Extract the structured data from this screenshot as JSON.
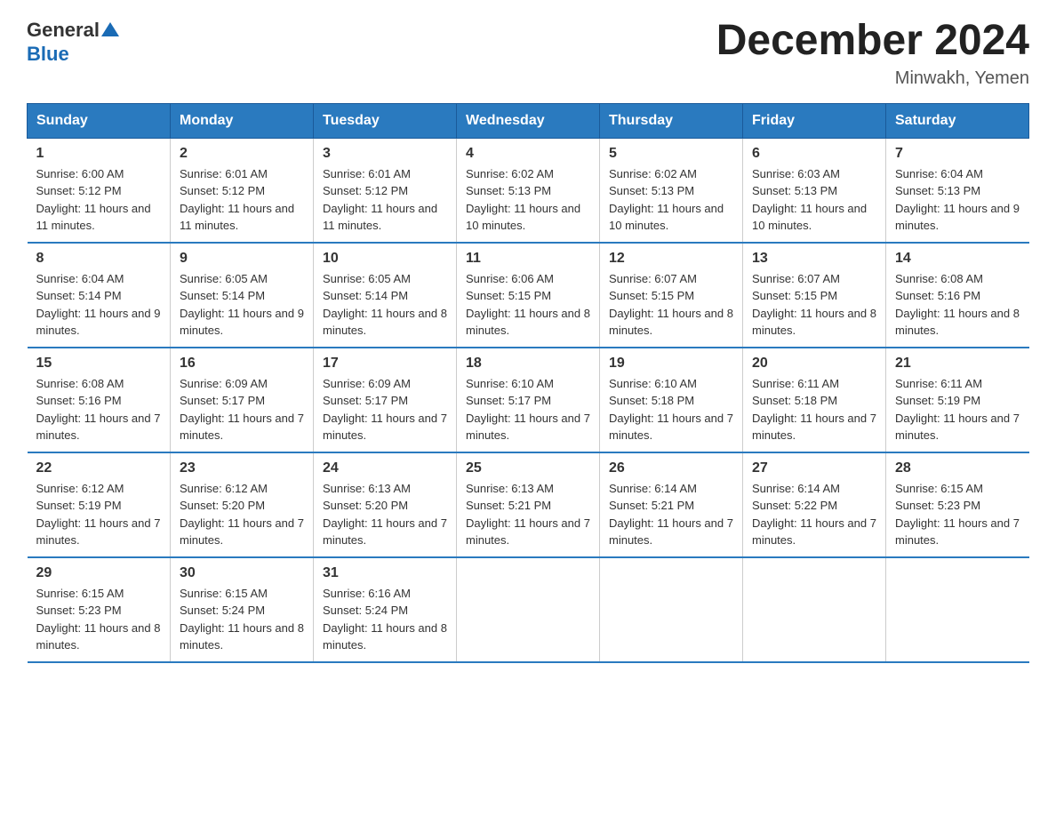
{
  "header": {
    "logo_general": "General",
    "logo_blue": "Blue",
    "month_title": "December 2024",
    "location": "Minwakh, Yemen"
  },
  "weekdays": [
    "Sunday",
    "Monday",
    "Tuesday",
    "Wednesday",
    "Thursday",
    "Friday",
    "Saturday"
  ],
  "weeks": [
    [
      {
        "day": "1",
        "sunrise": "6:00 AM",
        "sunset": "5:12 PM",
        "daylight": "11 hours and 11 minutes."
      },
      {
        "day": "2",
        "sunrise": "6:01 AM",
        "sunset": "5:12 PM",
        "daylight": "11 hours and 11 minutes."
      },
      {
        "day": "3",
        "sunrise": "6:01 AM",
        "sunset": "5:12 PM",
        "daylight": "11 hours and 11 minutes."
      },
      {
        "day": "4",
        "sunrise": "6:02 AM",
        "sunset": "5:13 PM",
        "daylight": "11 hours and 10 minutes."
      },
      {
        "day": "5",
        "sunrise": "6:02 AM",
        "sunset": "5:13 PM",
        "daylight": "11 hours and 10 minutes."
      },
      {
        "day": "6",
        "sunrise": "6:03 AM",
        "sunset": "5:13 PM",
        "daylight": "11 hours and 10 minutes."
      },
      {
        "day": "7",
        "sunrise": "6:04 AM",
        "sunset": "5:13 PM",
        "daylight": "11 hours and 9 minutes."
      }
    ],
    [
      {
        "day": "8",
        "sunrise": "6:04 AM",
        "sunset": "5:14 PM",
        "daylight": "11 hours and 9 minutes."
      },
      {
        "day": "9",
        "sunrise": "6:05 AM",
        "sunset": "5:14 PM",
        "daylight": "11 hours and 9 minutes."
      },
      {
        "day": "10",
        "sunrise": "6:05 AM",
        "sunset": "5:14 PM",
        "daylight": "11 hours and 8 minutes."
      },
      {
        "day": "11",
        "sunrise": "6:06 AM",
        "sunset": "5:15 PM",
        "daylight": "11 hours and 8 minutes."
      },
      {
        "day": "12",
        "sunrise": "6:07 AM",
        "sunset": "5:15 PM",
        "daylight": "11 hours and 8 minutes."
      },
      {
        "day": "13",
        "sunrise": "6:07 AM",
        "sunset": "5:15 PM",
        "daylight": "11 hours and 8 minutes."
      },
      {
        "day": "14",
        "sunrise": "6:08 AM",
        "sunset": "5:16 PM",
        "daylight": "11 hours and 8 minutes."
      }
    ],
    [
      {
        "day": "15",
        "sunrise": "6:08 AM",
        "sunset": "5:16 PM",
        "daylight": "11 hours and 7 minutes."
      },
      {
        "day": "16",
        "sunrise": "6:09 AM",
        "sunset": "5:17 PM",
        "daylight": "11 hours and 7 minutes."
      },
      {
        "day": "17",
        "sunrise": "6:09 AM",
        "sunset": "5:17 PM",
        "daylight": "11 hours and 7 minutes."
      },
      {
        "day": "18",
        "sunrise": "6:10 AM",
        "sunset": "5:17 PM",
        "daylight": "11 hours and 7 minutes."
      },
      {
        "day": "19",
        "sunrise": "6:10 AM",
        "sunset": "5:18 PM",
        "daylight": "11 hours and 7 minutes."
      },
      {
        "day": "20",
        "sunrise": "6:11 AM",
        "sunset": "5:18 PM",
        "daylight": "11 hours and 7 minutes."
      },
      {
        "day": "21",
        "sunrise": "6:11 AM",
        "sunset": "5:19 PM",
        "daylight": "11 hours and 7 minutes."
      }
    ],
    [
      {
        "day": "22",
        "sunrise": "6:12 AM",
        "sunset": "5:19 PM",
        "daylight": "11 hours and 7 minutes."
      },
      {
        "day": "23",
        "sunrise": "6:12 AM",
        "sunset": "5:20 PM",
        "daylight": "11 hours and 7 minutes."
      },
      {
        "day": "24",
        "sunrise": "6:13 AM",
        "sunset": "5:20 PM",
        "daylight": "11 hours and 7 minutes."
      },
      {
        "day": "25",
        "sunrise": "6:13 AM",
        "sunset": "5:21 PM",
        "daylight": "11 hours and 7 minutes."
      },
      {
        "day": "26",
        "sunrise": "6:14 AM",
        "sunset": "5:21 PM",
        "daylight": "11 hours and 7 minutes."
      },
      {
        "day": "27",
        "sunrise": "6:14 AM",
        "sunset": "5:22 PM",
        "daylight": "11 hours and 7 minutes."
      },
      {
        "day": "28",
        "sunrise": "6:15 AM",
        "sunset": "5:23 PM",
        "daylight": "11 hours and 7 minutes."
      }
    ],
    [
      {
        "day": "29",
        "sunrise": "6:15 AM",
        "sunset": "5:23 PM",
        "daylight": "11 hours and 8 minutes."
      },
      {
        "day": "30",
        "sunrise": "6:15 AM",
        "sunset": "5:24 PM",
        "daylight": "11 hours and 8 minutes."
      },
      {
        "day": "31",
        "sunrise": "6:16 AM",
        "sunset": "5:24 PM",
        "daylight": "11 hours and 8 minutes."
      },
      {
        "day": "",
        "sunrise": "",
        "sunset": "",
        "daylight": ""
      },
      {
        "day": "",
        "sunrise": "",
        "sunset": "",
        "daylight": ""
      },
      {
        "day": "",
        "sunrise": "",
        "sunset": "",
        "daylight": ""
      },
      {
        "day": "",
        "sunrise": "",
        "sunset": "",
        "daylight": ""
      }
    ]
  ],
  "labels": {
    "sunrise": "Sunrise:",
    "sunset": "Sunset:",
    "daylight": "Daylight:"
  }
}
